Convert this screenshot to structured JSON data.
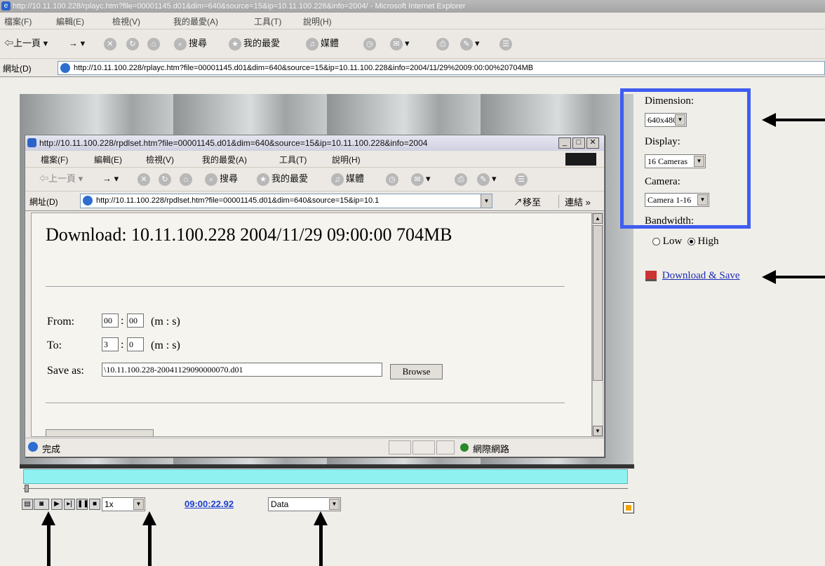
{
  "browser": {
    "title": "http://10.11.100.228/rplayc.htm?file=00001145.d01&dim=640&source=15&ip=10.11.100.228&info=2004/ - Microsoft Internet Explorer",
    "menu": [
      "檔案(F)",
      "編輯(E)",
      "檢視(V)",
      "我的最愛(A)",
      "工具(T)",
      "說明(H)"
    ],
    "toolbar": {
      "back": "上一頁",
      "search": "搜尋",
      "favorites": "我的最愛",
      "media": "媒體"
    },
    "address_label": "網址(D)",
    "address_value": "http://10.11.100.228/rplayc.htm?file=00001145.d01&dim=640&source=15&ip=10.11.100.228&info=2004/11/29%2009:00:00%20704MB"
  },
  "popup": {
    "title": "http://10.11.100.228/rpdlset.htm?file=00001145.d01&dim=640&source=15&ip=10.11.100.228&info=2004",
    "menu": [
      "檔案(F)",
      "編輯(E)",
      "檢視(V)",
      "我的最愛(A)",
      "工具(T)",
      "說明(H)"
    ],
    "toolbar": {
      "back": "上一頁",
      "search": "搜尋",
      "favorites": "我的最愛",
      "media": "媒體"
    },
    "address_label": "網址(D)",
    "address_value": "http://10.11.100.228/rpdlset.htm?file=00001145.d01&dim=640&source=15&ip=10.1",
    "go_label": "移至",
    "links_label": "連結 »",
    "download_title": "Download: 10.11.100.228  2004/11/29 09:00:00 704MB",
    "from_label": "From:",
    "from_m": "00",
    "from_s": "00",
    "to_label": "To:",
    "to_m": "3",
    "to_s": "0",
    "unit_label": "(m : s)",
    "colon": ":",
    "save_as_label": "Save as:",
    "save_as_value": "\\10.11.100.228-20041129090000070.d01",
    "browse_label": "Browse",
    "status_done": "完成",
    "status_zone": "網際網路"
  },
  "settings": {
    "dimension_label": "Dimension:",
    "dimension_value": "640x480",
    "display_label": "Display:",
    "display_value": "16 Cameras",
    "camera_label": "Camera:",
    "camera_value": "Camera 1-16",
    "bandwidth_label": "Bandwidth:",
    "bw_low": "Low",
    "bw_high": "High",
    "bw_selected": "High",
    "download_link": "Download & Save"
  },
  "player": {
    "speed": "1x",
    "timecode": "09:00:22.92",
    "mode": "Data"
  },
  "colors": {
    "highlight": "#3f5df0",
    "timeline": "#8ff2f1",
    "link": "#1a2cb4"
  }
}
